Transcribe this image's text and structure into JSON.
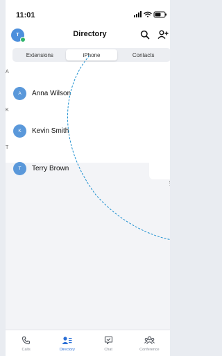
{
  "status_bar": {
    "time": "11:01"
  },
  "header": {
    "title": "Directory",
    "avatar_initial": "T"
  },
  "segments": [
    {
      "label": "Extensions",
      "active": false
    },
    {
      "label": "iPhone",
      "active": true
    },
    {
      "label": "Contacts",
      "active": false
    }
  ],
  "sections": [
    {
      "letter": "A",
      "contacts": [
        {
          "initial": "A",
          "name": "Anna Wilson"
        }
      ]
    },
    {
      "letter": "K",
      "contacts": [
        {
          "initial": "K",
          "name": "Kevin Smith"
        }
      ]
    },
    {
      "letter": "T",
      "contacts": [
        {
          "initial": "T",
          "name": "Terry Brown"
        }
      ]
    }
  ],
  "edge_index": [
    "5",
    "T"
  ],
  "tabbar": [
    {
      "label": "Calls",
      "icon": "phone-icon",
      "active": false
    },
    {
      "label": "Directory",
      "icon": "contacts-icon",
      "active": true
    },
    {
      "label": "Chat",
      "icon": "chat-icon",
      "active": false
    },
    {
      "label": "Conference",
      "icon": "conference-icon",
      "active": false
    }
  ],
  "colors": {
    "accent": "#2b6fd6",
    "avatar": "#5a98da",
    "online": "#2fb36a",
    "annotation": "#1e90d0"
  }
}
